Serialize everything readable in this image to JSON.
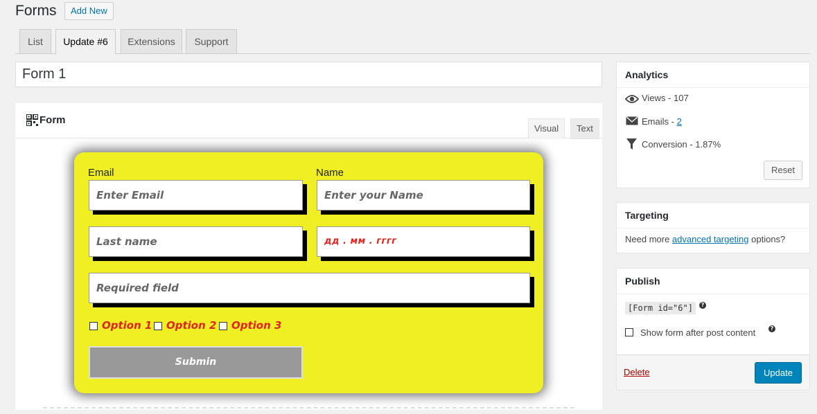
{
  "header": {
    "title": "Forms",
    "add_new": "Add New"
  },
  "tabs": [
    {
      "label": "List"
    },
    {
      "label": "Update #6"
    },
    {
      "label": "Extensions"
    },
    {
      "label": "Support"
    }
  ],
  "form_title": "Form 1",
  "editor": {
    "title": "Form",
    "tab_visual": "Visual",
    "tab_text": "Text"
  },
  "form_preview": {
    "email_label": "Email",
    "name_label": "Name",
    "email_placeholder": "Enter Email",
    "name_placeholder": "Enter your Name",
    "lastname_placeholder": "Last name",
    "date_placeholder": "дд . мм . гггг",
    "required_placeholder": "Required field",
    "options": [
      "Option 1",
      "Option 2",
      "Option 3"
    ],
    "submit_label": "Submin",
    "background_color": "#efef23"
  },
  "analytics": {
    "title": "Analytics",
    "views_label": "Views - 107",
    "emails_label": "Emails - ",
    "emails_count": "2",
    "conversion_label": "Conversion - 1.87%",
    "reset": "Reset"
  },
  "targeting": {
    "title": "Targeting",
    "text_before": "Need more ",
    "link": "advanced targeting",
    "text_after": " options?"
  },
  "publish": {
    "title": "Publish",
    "shortcode": "[Form id=\"6\"]",
    "show_after_label": "Show form after post content",
    "delete": "Delete",
    "update": "Update"
  },
  "colors": {
    "accent": "#0085ba",
    "link": "#0073aa",
    "danger": "#a00",
    "option_text": "#e0241f"
  }
}
